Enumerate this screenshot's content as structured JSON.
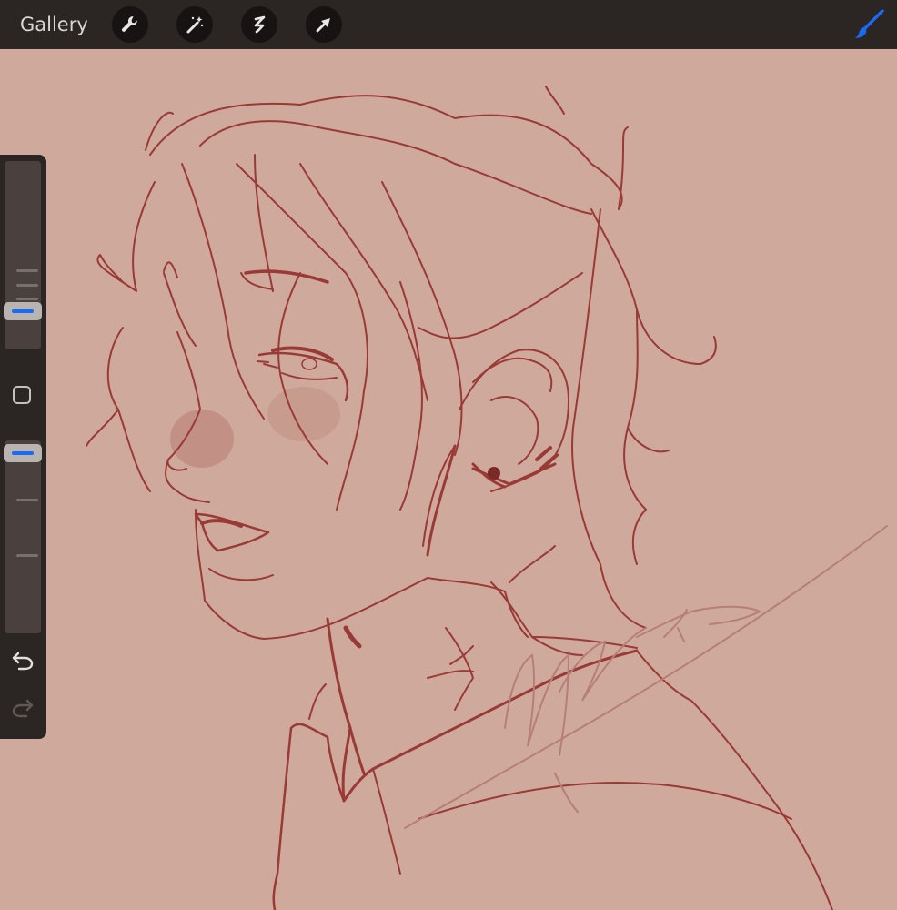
{
  "topbar": {
    "gallery_label": "Gallery",
    "tools": [
      {
        "name": "actions",
        "icon": "wrench-icon"
      },
      {
        "name": "adjustments",
        "icon": "magic-wand-icon"
      },
      {
        "name": "selection",
        "icon": "selection-s-icon"
      },
      {
        "name": "transform",
        "icon": "arrow-cursor-icon"
      }
    ],
    "active_tool_icon": "paintbrush-icon",
    "accent_color": "#1a6bf0"
  },
  "canvas": {
    "background_color": "#cfa99c",
    "line_color": "#9a3a36",
    "content": "sketch-portrait"
  },
  "sidebar": {
    "brush_size_level": 0.23,
    "brush_opacity_level": 0.95,
    "modify_icon": "square-icon",
    "undo_icon": "undo-arrow-icon",
    "redo_icon": "redo-arrow-icon",
    "redo_enabled": false
  }
}
